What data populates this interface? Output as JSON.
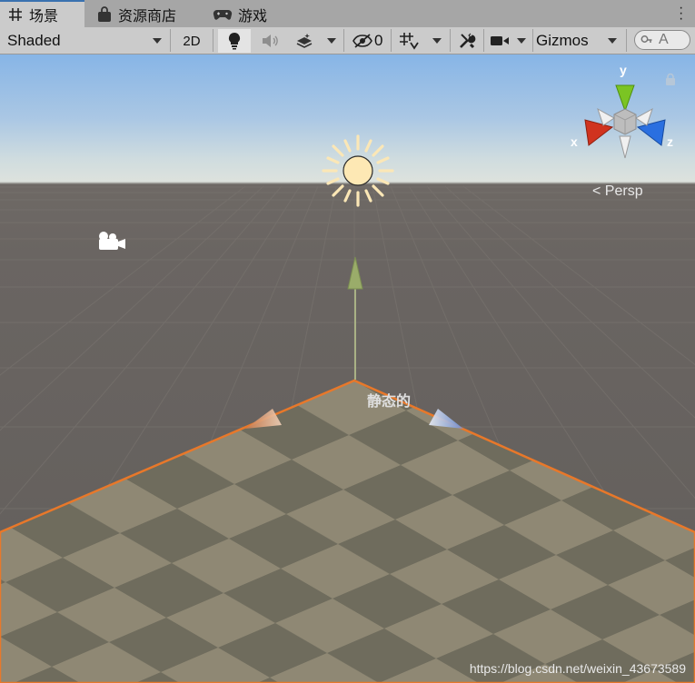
{
  "tabs": [
    {
      "label": "场景",
      "icon": "grid-icon",
      "active": true
    },
    {
      "label": "资源商店",
      "icon": "store-bag-icon",
      "active": false
    },
    {
      "label": "游戏",
      "icon": "gamepad-icon",
      "active": false
    }
  ],
  "toolbar": {
    "draw_mode": "Shaded",
    "mode_2d": "2D",
    "hidden_count": "0",
    "gizmos": "Gizmos",
    "search_placeholder": "A"
  },
  "scene": {
    "view_mode": "Persp",
    "axis_x": "x",
    "axis_y": "y",
    "axis_z": "z",
    "object_label": "静态的"
  },
  "watermark": "https://blog.csdn.net/weixin_43673589",
  "colors": {
    "selection_outline": "#e8782a",
    "axis_x": "#d0331f",
    "axis_y": "#7bc423",
    "axis_z": "#2a6fe0",
    "tab_accent": "#3a72b0"
  }
}
